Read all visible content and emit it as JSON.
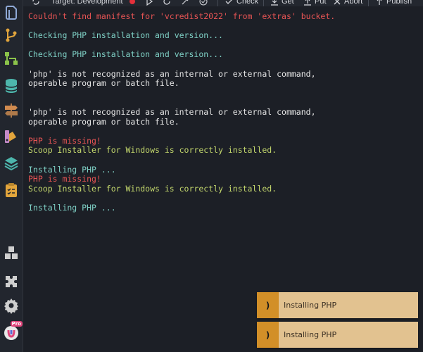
{
  "toolbar": {
    "target_label": "Target: Development",
    "check_label": "Check",
    "get_label": "Get",
    "put_label": "Put",
    "abort_label": "Abort",
    "publish_label": "Publish"
  },
  "terminal": {
    "lines": [
      {
        "text": "Couldn't find manifest for 'vcredist2022' from 'extras' bucket.",
        "kind": "error"
      },
      {
        "text": "",
        "kind": "blank"
      },
      {
        "text": "Checking PHP installation and version...",
        "kind": "info"
      },
      {
        "text": "",
        "kind": "blank"
      },
      {
        "text": "Checking PHP installation and version...",
        "kind": "info"
      },
      {
        "text": "",
        "kind": "blank"
      },
      {
        "text": "'php' is not recognized as an internal or external command,",
        "kind": "plain"
      },
      {
        "text": "operable program or batch file.",
        "kind": "plain"
      },
      {
        "text": "",
        "kind": "blank"
      },
      {
        "text": "",
        "kind": "blank"
      },
      {
        "text": "'php' is not recognized as an internal or external command,",
        "kind": "plain"
      },
      {
        "text": "operable program or batch file.",
        "kind": "plain"
      },
      {
        "text": "",
        "kind": "blank"
      },
      {
        "text": "PHP is missing!",
        "kind": "error"
      },
      {
        "text": "Scoop Installer for Windows is correctly installed.",
        "kind": "success"
      },
      {
        "text": "",
        "kind": "blank"
      },
      {
        "text": "Installing PHP ...",
        "kind": "info"
      },
      {
        "text": "PHP is missing!",
        "kind": "error"
      },
      {
        "text": "Scoop Installer for Windows is correctly installed.",
        "kind": "success"
      },
      {
        "text": "",
        "kind": "blank"
      },
      {
        "text": "Installing PHP ...",
        "kind": "info"
      }
    ]
  },
  "toasts": [
    {
      "message": "Installing PHP",
      "icon": ")"
    },
    {
      "message": "Installing PHP",
      "icon": ")"
    }
  ],
  "activity_bar": {
    "icons": [
      "explorer-icon",
      "source-control-icon",
      "branches-icon",
      "database-icon",
      "signpost-icon",
      "palette-icon",
      "layers-icon",
      "clipboard-checklist-icon",
      "packages-icon",
      "puzzle-icon",
      "gear-icon",
      "pro-account-icon"
    ],
    "pro_badge": "Pro"
  },
  "colors": {
    "background": "#1c1f26",
    "error": "#e65454",
    "info": "#7fd1c6",
    "success": "#c4d86d",
    "plain": "#e6e6e6",
    "toast_bg": "#e2c290",
    "toast_accent": "#d28f28"
  }
}
